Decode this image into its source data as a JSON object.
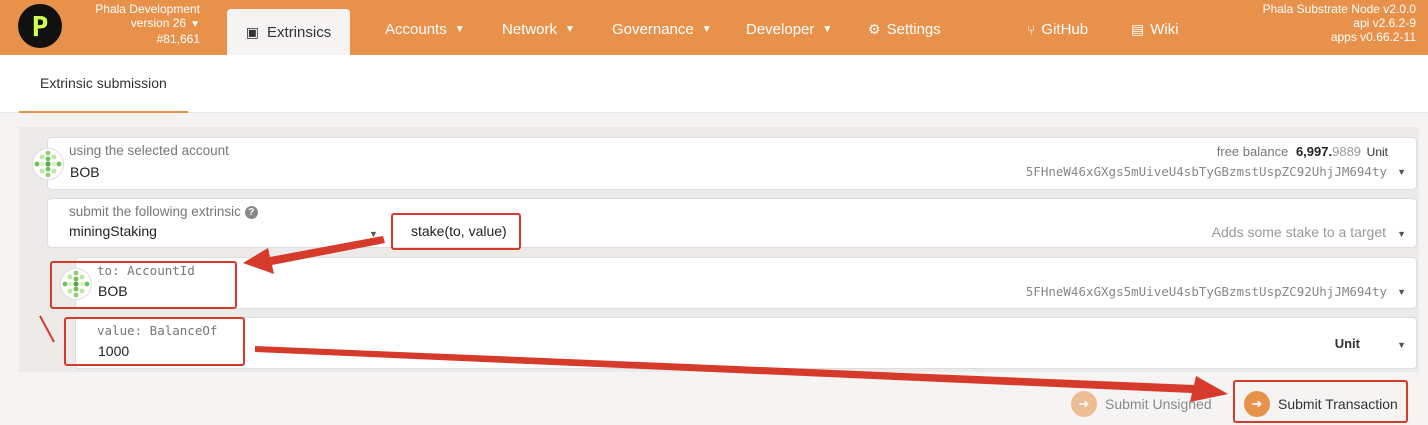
{
  "header": {
    "chain_name": "Phala Development",
    "version": "version 26",
    "block": "#81,661",
    "logo_letter": "P",
    "active_tab": "Extrinsics",
    "nav": [
      {
        "label": "Accounts"
      },
      {
        "label": "Network"
      },
      {
        "label": "Governance"
      },
      {
        "label": "Developer"
      },
      {
        "label": "Settings"
      },
      {
        "label": "GitHub"
      },
      {
        "label": "Wiki"
      }
    ],
    "node_name": "Phala Substrate Node v2.0.0",
    "api_version": "api v2.6.2-9",
    "apps_version": "apps v0.66.2-11",
    "accent_color": "#e8914b"
  },
  "subtabs": {
    "active": "Extrinsic submission"
  },
  "form": {
    "account": {
      "label": "using the selected account",
      "name": "BOB",
      "address": "5FHneW46xGXgs5mUiveU4sbTyGBzmstUspZC92UhjJM694ty",
      "balance_label": "free balance",
      "balance_main": "6,997.",
      "balance_decimals": "9889",
      "balance_unit": "Unit"
    },
    "extrinsic": {
      "label": "submit the following extrinsic",
      "module": "miningStaking",
      "method": "stake(to, value)",
      "description": "Adds some stake to a target"
    },
    "param_to": {
      "label": "to: AccountId",
      "name": "BOB",
      "address": "5FHneW46xGXgs5mUiveU4sbTyGBzmstUspZC92UhjJM694ty"
    },
    "param_value": {
      "label": "value: BalanceOf",
      "value": "1000",
      "unit": "Unit"
    }
  },
  "actions": {
    "submit_unsigned": "Submit Unsigned",
    "submit_transaction": "Submit Transaction"
  },
  "annotation_color": "#d63a2a"
}
